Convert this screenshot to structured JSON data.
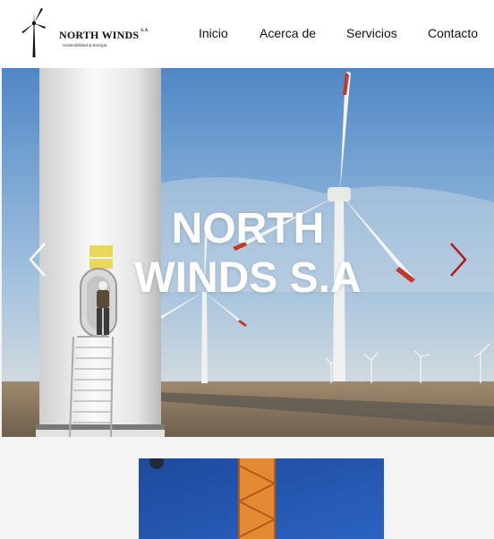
{
  "header": {
    "brand_name": "NORTH WINDS",
    "brand_suffix": "S.A",
    "tagline": "Sostenibilidad & Energía",
    "nav": [
      "Inicio",
      "Acerca de",
      "Servicios",
      "Contacto"
    ]
  },
  "hero": {
    "title_line1": "NORTH",
    "title_line2": "WINDS S.A"
  },
  "colors": {
    "accent_arrow": "#b51d1d",
    "header_bg": "#ffffff",
    "page_bg": "#f4f4f4"
  },
  "icons": {
    "prev": "chevron-left-icon",
    "next": "chevron-right-icon",
    "logo": "wind-turbine-logo-icon"
  }
}
